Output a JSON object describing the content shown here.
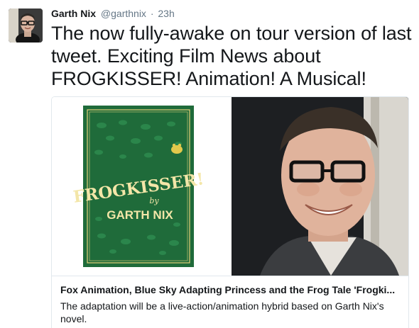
{
  "author": {
    "name": "Garth Nix",
    "handle": "@garthnix",
    "separator": "·",
    "timestamp": "23h"
  },
  "tweet": {
    "text": "The now fully-awake on tour version of last tweet. Exciting Film News about FROGKISSER! Animation! A Musical!"
  },
  "card": {
    "title": "Fox Animation, Blue Sky Adapting Princess and the Frog Tale 'Frogki...",
    "description": "The adaptation will be a live-action/animation hybrid based on Garth Nix's novel.",
    "book": {
      "title_line": "FROGKISSER!",
      "by_word": "by",
      "author_line": "GARTH NIX"
    }
  },
  "colors": {
    "book_green": "#1f6b3a",
    "book_green_dark": "#16542c",
    "book_gold": "#e6d27a",
    "text_primary": "#14171a",
    "text_secondary": "#657786"
  }
}
